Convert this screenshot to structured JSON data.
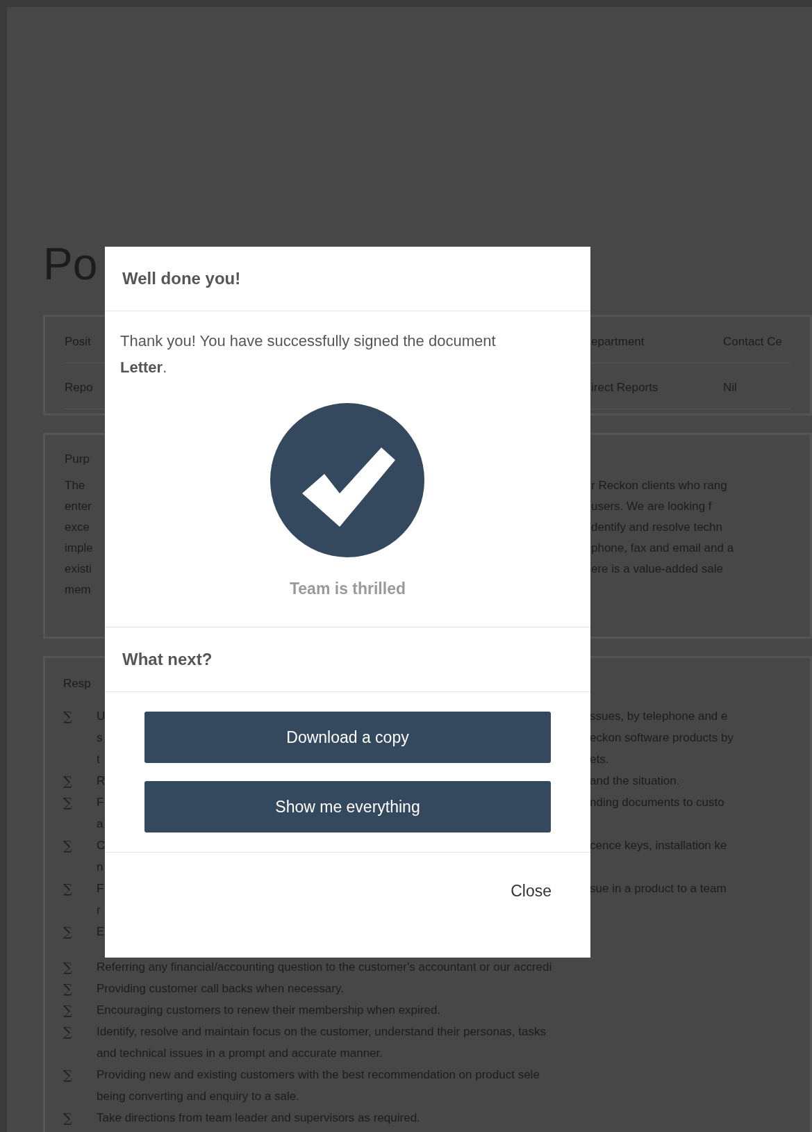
{
  "document": {
    "title_fragment": "Po",
    "info_table": {
      "rows": [
        {
          "left": "Posit",
          "right_label": "epartment",
          "right_value": "Contact Ce"
        },
        {
          "left": "Repo",
          "right_label": "irect Reports",
          "right_value": "Nil"
        }
      ]
    },
    "purpose": {
      "heading_fragment": "Purp",
      "lines": [
        {
          "left": "The",
          "right": "r Reckon clients who rang"
        },
        {
          "left": "enter",
          "right": "users.  We are looking f"
        },
        {
          "left": "exce",
          "right": "dentify and resolve techn"
        },
        {
          "left": "imple",
          "right": "phone, fax and email and a"
        },
        {
          "left": "existi",
          "right": "ere is a value-added sale"
        },
        {
          "left": "mem"
        }
      ]
    },
    "responsibilities": {
      "heading_fragment": "Resp",
      "lines": [
        {
          "marker": "∑",
          "left": "U",
          "right": "ssues, by telephone and e"
        },
        {
          "left": "s",
          "right": "eckon software products by"
        },
        {
          "left": "t",
          "right": "ets."
        },
        {
          "marker": "∑",
          "left": "R",
          "right": "and the situation."
        },
        {
          "marker": "∑",
          "left": "F",
          "right": "nding documents to custo"
        },
        {
          "left": "a"
        },
        {
          "marker": "∑",
          "left": "C",
          "right": "cence keys, installation ke"
        },
        {
          "left": "n"
        },
        {
          "marker": "∑",
          "left": "F",
          "right": "sue in a product to a team"
        },
        {
          "left": "r"
        },
        {
          "marker": "∑",
          "left": "E"
        }
      ],
      "full_lines": [
        {
          "marker": "∑",
          "text": "Referring any financial/accounting question to the customer's accountant or our accredi"
        },
        {
          "marker": "∑",
          "text": "Providing customer call backs when necessary."
        },
        {
          "marker": "∑",
          "text": "Encouraging customers to renew their membership when expired."
        },
        {
          "marker": "∑",
          "text": "Identify, resolve and maintain focus on the customer, understand their personas, tasks"
        },
        {
          "text": "and technical issues in a prompt and accurate manner."
        },
        {
          "marker": "∑",
          "text": "Providing new and existing customers with the best recommendation on product sele"
        },
        {
          "text": "being converting and enquiry to a sale."
        },
        {
          "marker": "∑",
          "text": "Take directions from team leader and supervisors as required."
        }
      ]
    }
  },
  "dialog": {
    "title": "Well done you!",
    "message": "Thank you! You have successfully signed the document **Letter**.",
    "caption": "Team is thrilled",
    "section_title": "What next?",
    "buttons": [
      {
        "label": "Download a copy"
      },
      {
        "label": "Show me everything"
      }
    ],
    "close": "Close"
  }
}
